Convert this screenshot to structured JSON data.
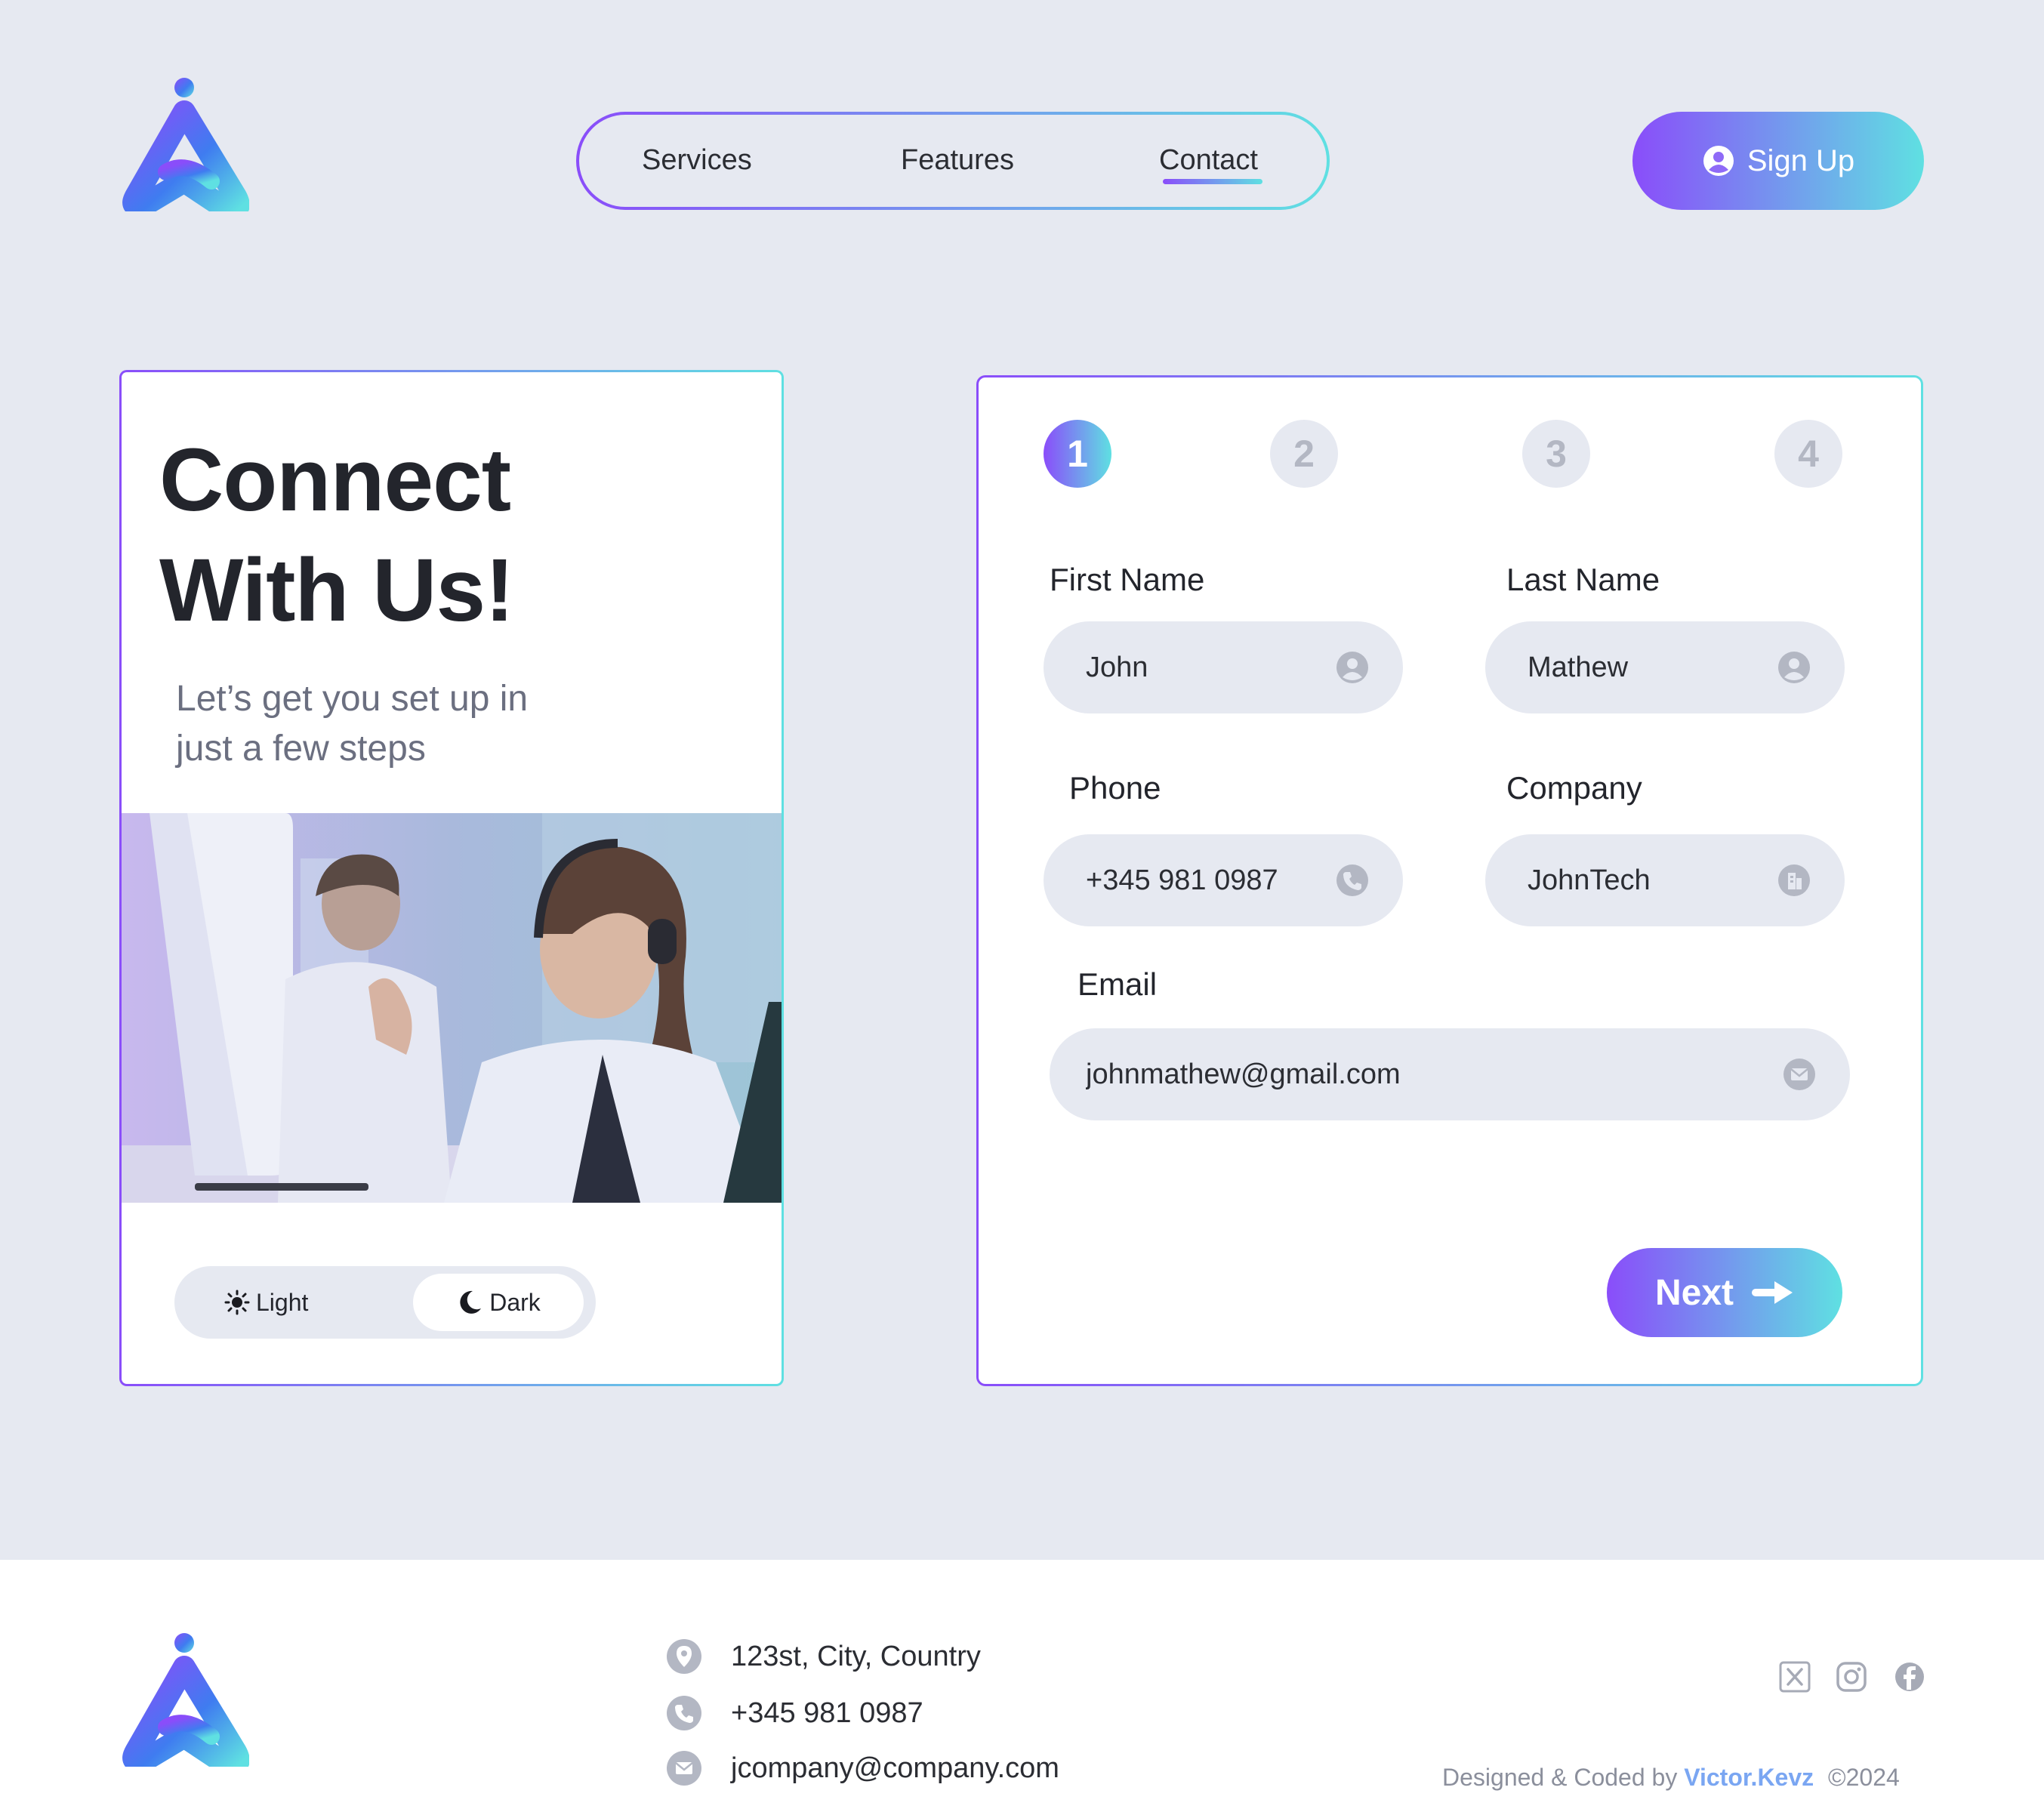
{
  "header": {
    "nav": [
      {
        "label": "Services"
      },
      {
        "label": "Features"
      },
      {
        "label": "Contact"
      }
    ],
    "signup_label": "Sign Up"
  },
  "hero": {
    "title_line1": "Connect",
    "title_line2": "With Us!",
    "subtitle_line1": "Let’s get you set up in",
    "subtitle_line2": "just a few steps"
  },
  "theme_toggle": {
    "light_label": "Light",
    "dark_label": "Dark",
    "selected": "Dark"
  },
  "form": {
    "steps": [
      "1",
      "2",
      "3",
      "4"
    ],
    "active_step": "1",
    "first_name": {
      "label": "First Name",
      "value": "John",
      "icon": "user-icon"
    },
    "last_name": {
      "label": "Last Name",
      "value": "Mathew",
      "icon": "user-icon"
    },
    "phone": {
      "label": "Phone",
      "value": "+345 981 0987",
      "icon": "phone-icon"
    },
    "company": {
      "label": "Company",
      "value": "JohnTech",
      "icon": "building-icon"
    },
    "email": {
      "label": "Email",
      "value": "johnmathew@gmail.com",
      "icon": "mail-icon"
    },
    "next_label": "Next"
  },
  "footer": {
    "address": "123st, City, Country",
    "phone": "+345 981 0987",
    "email": "jcompany@company.com",
    "credit_prefix": "Designed & Coded by",
    "credit_author": "Victor.Kevz",
    "credit_year": "©2024",
    "social": [
      "x-icon",
      "instagram-icon",
      "facebook-icon"
    ]
  },
  "colors": {
    "background": "#e6e9f1",
    "gradient_start": "#8a4dfa",
    "gradient_end": "#5fe0e2",
    "text": "#23252c",
    "muted": "#b3b7c3",
    "author_link": "#7aa6f2"
  }
}
